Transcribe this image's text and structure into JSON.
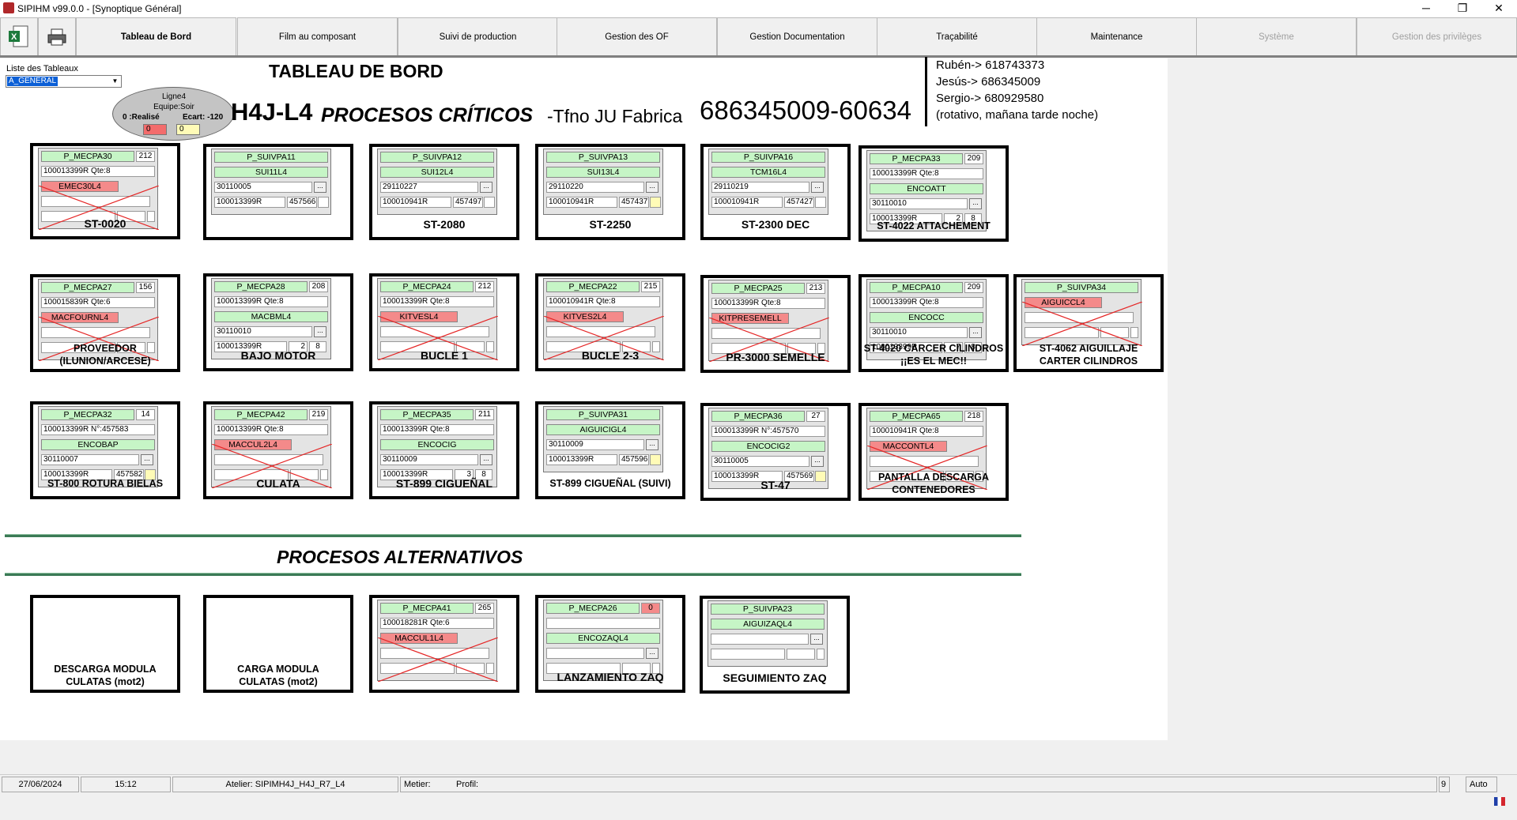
{
  "window": {
    "title": "SIPIHM v99.0.0 - [Synoptique Général]",
    "min": "─",
    "max": "❐",
    "close": "✕"
  },
  "menu": [
    "Tableau de Bord",
    "Film au composant",
    "Suivi de production",
    "Gestion des OF",
    "Gestion Documentation",
    "Traçabilité",
    "Maintenance",
    "Système",
    "Gestion des privilèges"
  ],
  "menu_icons": {
    "excel": "excel-icon",
    "print": "printer-icon"
  },
  "list": {
    "label": "Liste des Tableaux",
    "value": "A_GENERAL"
  },
  "oval": {
    "line": "Ligne4",
    "equipe": "Equipe:Soir",
    "realise": "0 :Realisé",
    "ecart": "Ecart: -120",
    "v1": "0",
    "v2": "0"
  },
  "header": {
    "title": "TABLEAU DE BORD",
    "line": "H4J-L4",
    "procesos": "PROCESOS CRÍTICOS",
    "tfno": "-Tfno JU Fabrica",
    "number": "686345009-60634"
  },
  "contacts": [
    "Rubén-> 618743373",
    "Jesús-> 686345009",
    "Sergio-> 680929580",
    "(rotativo, mañana tarde noche)"
  ],
  "alternativos": "PROCESOS ALTERNATIVOS",
  "boards": [
    {
      "label": "ST-0020",
      "rows": [
        {
          "k": "g",
          "t": "P_MECPA30",
          "n": "212"
        },
        {
          "k": "w",
          "t": "100013399R     Qte:8"
        },
        {
          "k": "r",
          "t": "EMEC30L4"
        },
        {
          "k": "e"
        },
        {
          "k": "e2"
        }
      ],
      "cross": true
    },
    {
      "label": "",
      "rows": [
        {
          "k": "g",
          "t": "P_SUIVPA11"
        },
        {
          "k": "g",
          "t": "SUI11L4"
        },
        {
          "k": "d",
          "t": "30110005"
        },
        {
          "k": "w2",
          "t": "100013399R",
          "t2": "457566"
        }
      ]
    },
    {
      "label": "ST-2080",
      "rows": [
        {
          "k": "g",
          "t": "P_SUIVPA12"
        },
        {
          "k": "g",
          "t": "SUI12L4"
        },
        {
          "k": "d",
          "t": "29110227"
        },
        {
          "k": "w2",
          "t": "100010941R",
          "t2": "457497"
        }
      ]
    },
    {
      "label": "ST-2250",
      "rows": [
        {
          "k": "g",
          "t": "P_SUIVPA13"
        },
        {
          "k": "g",
          "t": "SUI13L4"
        },
        {
          "k": "d",
          "t": "29110220"
        },
        {
          "k": "w2y",
          "t": "100010941R",
          "t2": "457437"
        }
      ]
    },
    {
      "label": "ST-2300 DEC",
      "rows": [
        {
          "k": "g",
          "t": "P_SUIVPA16"
        },
        {
          "k": "g",
          "t": "TCM16L4"
        },
        {
          "k": "d",
          "t": "29110219"
        },
        {
          "k": "w2",
          "t": "100010941R",
          "t2": "457427"
        }
      ]
    },
    {
      "label": "ST-4022 ATTACHEMENT",
      "rows": [
        {
          "k": "g",
          "t": "P_MECPA33",
          "n": "209"
        },
        {
          "k": "w",
          "t": "100013399R     Qte:8"
        },
        {
          "k": "g",
          "t": "ENCOATT"
        },
        {
          "k": "d",
          "t": "30110010"
        },
        {
          "k": "q",
          "t": "100013399R",
          "a": "2",
          "b": "8"
        }
      ]
    },
    {
      "label": "PROVEEDOR\n(ILUNION/ARCESE)",
      "rows": [
        {
          "k": "g",
          "t": "P_MECPA27",
          "n": "156"
        },
        {
          "k": "w",
          "t": "100015839R     Qte:6"
        },
        {
          "k": "r",
          "t": "MACFOURNL4"
        },
        {
          "k": "e"
        },
        {
          "k": "e2"
        }
      ],
      "cross": true
    },
    {
      "label": "BAJO MOTOR",
      "rows": [
        {
          "k": "g",
          "t": "P_MECPA28",
          "n": "208"
        },
        {
          "k": "w",
          "t": "100013399R     Qte:8"
        },
        {
          "k": "g",
          "t": "MACBML4"
        },
        {
          "k": "d",
          "t": "30110010"
        },
        {
          "k": "q",
          "t": "100013399R",
          "a": "2",
          "b": "8"
        }
      ]
    },
    {
      "label": "BUCLE 1",
      "rows": [
        {
          "k": "g",
          "t": "P_MECPA24",
          "n": "212"
        },
        {
          "k": "w",
          "t": "100013399R     Qte:8"
        },
        {
          "k": "r",
          "t": "KITVESL4"
        },
        {
          "k": "e"
        },
        {
          "k": "e2"
        }
      ],
      "cross": true
    },
    {
      "label": "BUCLE 2-3",
      "rows": [
        {
          "k": "g",
          "t": "P_MECPA22",
          "n": "215"
        },
        {
          "k": "w",
          "t": "100010941R     Qte:8"
        },
        {
          "k": "r",
          "t": "KITVES2L4"
        },
        {
          "k": "e"
        },
        {
          "k": "e2"
        }
      ],
      "cross": true
    },
    {
      "label": "PR-3000 SEMELLE",
      "rows": [
        {
          "k": "g",
          "t": "P_MECPA25",
          "n": "213"
        },
        {
          "k": "w",
          "t": "100013399R     Qte:8"
        },
        {
          "k": "r",
          "t": "KITPRESEMELL"
        },
        {
          "k": "e"
        },
        {
          "k": "e2"
        }
      ],
      "cross": true
    },
    {
      "label": "ST-4020 CARCER CILINDROS\n¡¡ES EL MEC!!",
      "rows": [
        {
          "k": "g",
          "t": "P_MECPA10",
          "n": "209"
        },
        {
          "k": "w",
          "t": "100013399R     Qte:8"
        },
        {
          "k": "g",
          "t": "ENCOCC"
        },
        {
          "k": "d",
          "t": "30110010"
        },
        {
          "k": "q",
          "t": "100013399R",
          "a": "7",
          "b": "8"
        }
      ]
    },
    {
      "label": "ST-4062 AIGUILLAJE\nCARTER CILINDROS",
      "rows": [
        {
          "k": "g",
          "t": "P_SUIVPA34"
        },
        {
          "k": "r",
          "t": "AIGUICCL4"
        },
        {
          "k": "e"
        },
        {
          "k": "e2"
        }
      ],
      "cross": true
    },
    {
      "label": "ST-800 ROTURA BIELAS",
      "rows": [
        {
          "k": "g",
          "t": "P_MECPA32",
          "n": "14"
        },
        {
          "k": "w",
          "t": "100013399R   N°:457583"
        },
        {
          "k": "g",
          "t": "ENCOBAP"
        },
        {
          "k": "d",
          "t": "30110007"
        },
        {
          "k": "w2y",
          "t": "100013399R",
          "t2": "457582"
        }
      ]
    },
    {
      "label": "CULATA",
      "rows": [
        {
          "k": "g",
          "t": "P_MECPA42",
          "n": "219"
        },
        {
          "k": "w",
          "t": "100013399R     Qte:8"
        },
        {
          "k": "r",
          "t": "MACCUL2L4"
        },
        {
          "k": "e"
        },
        {
          "k": "e2"
        }
      ],
      "cross": true
    },
    {
      "label": "ST-899 CIGUEÑAL",
      "rows": [
        {
          "k": "g",
          "t": "P_MECPA35",
          "n": "211"
        },
        {
          "k": "w",
          "t": "100013399R     Qte:8"
        },
        {
          "k": "g",
          "t": "ENCOCIG"
        },
        {
          "k": "d",
          "t": "30110009"
        },
        {
          "k": "q",
          "t": "100013399R",
          "a": "3",
          "b": "8"
        }
      ]
    },
    {
      "label": "ST-899 CIGUEÑAL (SUIVI)",
      "rows": [
        {
          "k": "g",
          "t": "P_SUIVPA31"
        },
        {
          "k": "g",
          "t": "AIGUICIGL4"
        },
        {
          "k": "d",
          "t": "30110009"
        },
        {
          "k": "w2y",
          "t": "100013399R",
          "t2": "457596"
        }
      ]
    },
    {
      "label": "ST-47",
      "rows": [
        {
          "k": "g",
          "t": "P_MECPA36",
          "n": "27"
        },
        {
          "k": "w",
          "t": "100013399R   N°:457570"
        },
        {
          "k": "g",
          "t": "ENCOCIG2"
        },
        {
          "k": "d",
          "t": "30110005"
        },
        {
          "k": "w2y",
          "t": "100013399R",
          "t2": "457569"
        }
      ]
    },
    {
      "label": "PANTALLA DESCARGA\nCONTENEDORES",
      "rows": [
        {
          "k": "g",
          "t": "P_MECPA65",
          "n": "218"
        },
        {
          "k": "w",
          "t": "100010941R     Qte:8"
        },
        {
          "k": "r",
          "t": "MACCONTL4"
        },
        {
          "k": "e"
        },
        {
          "k": "e2"
        }
      ],
      "cross": true
    },
    {
      "label": "DESCARGA MODULA\nCULATAS (mot2)",
      "rows": []
    },
    {
      "label": "CARGA MODULA\nCULATAS (mot2)",
      "rows": []
    },
    {
      "label": "",
      "rows": [
        {
          "k": "g",
          "t": "P_MECPA41",
          "n": "265"
        },
        {
          "k": "w",
          "t": "100018281R     Qte:6"
        },
        {
          "k": "r",
          "t": "MACCUL1L4"
        },
        {
          "k": "e"
        },
        {
          "k": "e2"
        }
      ],
      "cross": true
    },
    {
      "label": "LANZAMIENTO ZAQ",
      "rows": [
        {
          "k": "g",
          "t": "P_MECPA26",
          "n": "0",
          "nr": true
        },
        {
          "k": "w",
          "t": ""
        },
        {
          "k": "g",
          "t": "ENCOZAQL4"
        },
        {
          "k": "d",
          "t": ""
        },
        {
          "k": "e2"
        }
      ]
    },
    {
      "label": "SEGUIMIENTO ZAQ",
      "rows": [
        {
          "k": "g",
          "t": "P_SUIVPA23"
        },
        {
          "k": "g",
          "t": "AIGUIZAQL4"
        },
        {
          "k": "d",
          "t": ""
        },
        {
          "k": "e2"
        }
      ]
    }
  ],
  "status": {
    "date": "27/06/2024",
    "time": "15:12",
    "atelier": "Atelier: SIPIMH4J_H4J_R7_L4",
    "metier": "Metier:",
    "profil": "Profil:",
    "page": "9",
    "mode": "Auto"
  }
}
